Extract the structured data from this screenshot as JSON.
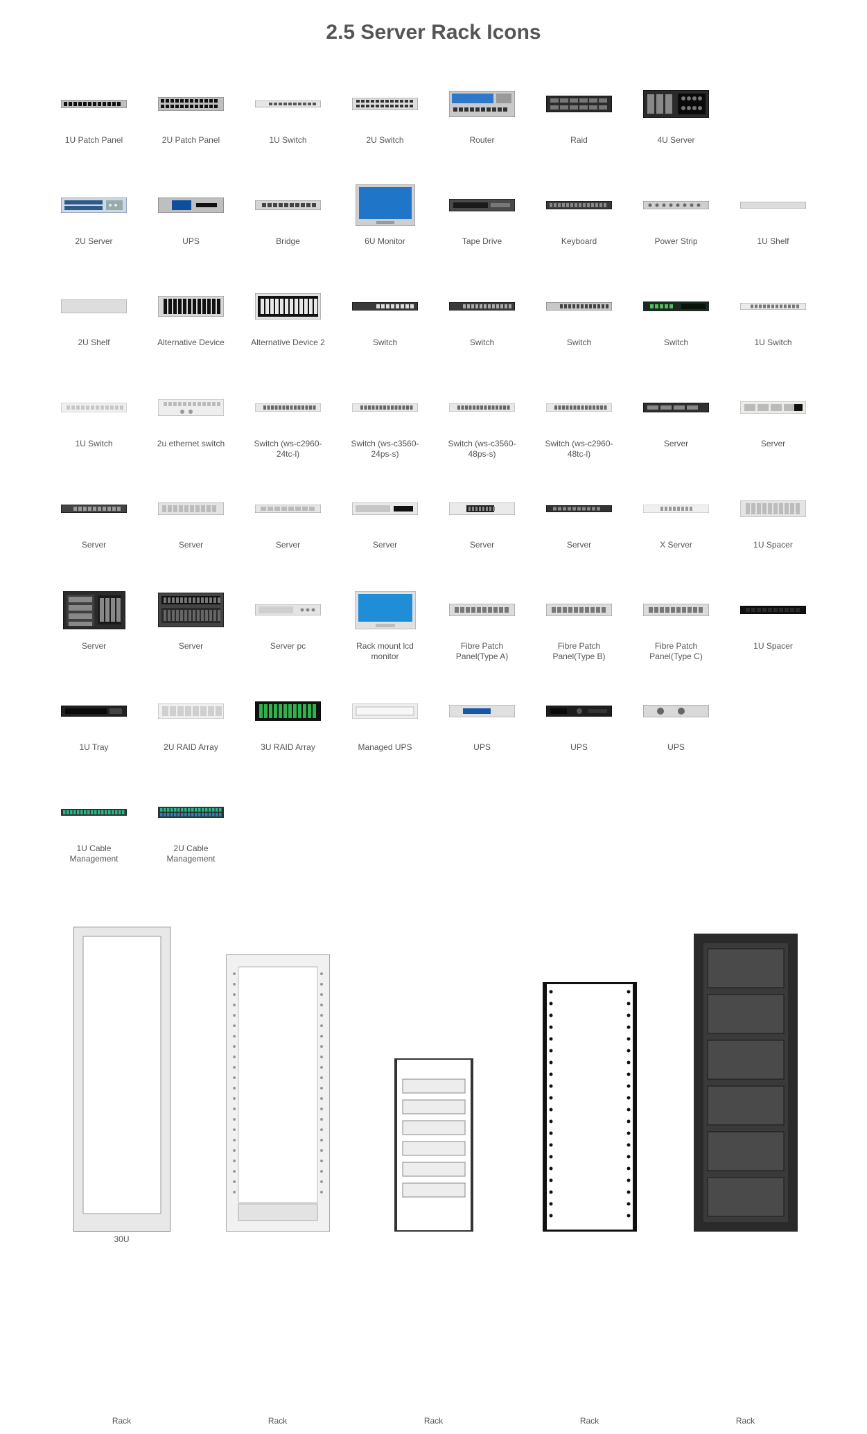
{
  "title": "2.5 Server Rack Icons",
  "items": [
    {
      "id": "1u-patch-panel",
      "label": "1U Patch Panel"
    },
    {
      "id": "2u-patch-panel",
      "label": "2U Patch Panel"
    },
    {
      "id": "1u-switch",
      "label": "1U Switch"
    },
    {
      "id": "2u-switch",
      "label": "2U Switch"
    },
    {
      "id": "router",
      "label": "Router"
    },
    {
      "id": "raid",
      "label": "Raid"
    },
    {
      "id": "4u-server",
      "label": "4U Server"
    },
    {
      "id": "blank",
      "label": ""
    },
    {
      "id": "2u-server",
      "label": "2U Server"
    },
    {
      "id": "ups",
      "label": "UPS"
    },
    {
      "id": "bridge",
      "label": "Bridge"
    },
    {
      "id": "6u-monitor",
      "label": "6U Monitor"
    },
    {
      "id": "tape-drive",
      "label": "Tape Drive"
    },
    {
      "id": "keyboard",
      "label": "Keyboard"
    },
    {
      "id": "power-strip",
      "label": "Power Strip"
    },
    {
      "id": "1u-shelf",
      "label": "1U Shelf"
    },
    {
      "id": "2u-shelf",
      "label": "2U Shelf"
    },
    {
      "id": "alternative-device",
      "label": "Alternative Device"
    },
    {
      "id": "alternative-device-2",
      "label": "Alternative Device 2"
    },
    {
      "id": "switch-a",
      "label": "Switch"
    },
    {
      "id": "switch-b",
      "label": "Switch"
    },
    {
      "id": "switch-c",
      "label": "Switch"
    },
    {
      "id": "switch-d",
      "label": "Switch"
    },
    {
      "id": "1u-switch-b",
      "label": "1U Switch"
    },
    {
      "id": "1u-switch-c",
      "label": "1U Switch"
    },
    {
      "id": "2u-ethernet-switch",
      "label": "2u ethernet switch"
    },
    {
      "id": "switch-ws-c2960-24tc-l",
      "label": "Switch (ws-c2960-24tc-l)"
    },
    {
      "id": "switch-ws-c3560-24ps-s",
      "label": "Switch (ws-c3560-24ps-s)"
    },
    {
      "id": "switch-ws-c3560-48ps-s",
      "label": "Switch (ws-c3560-48ps-s)"
    },
    {
      "id": "switch-ws-c2960-48tc-l",
      "label": "Switch (ws-c2960-48tc-l)"
    },
    {
      "id": "server-a",
      "label": "Server"
    },
    {
      "id": "server-b",
      "label": "Server"
    },
    {
      "id": "server-c",
      "label": "Server"
    },
    {
      "id": "server-d",
      "label": "Server"
    },
    {
      "id": "server-e",
      "label": "Server"
    },
    {
      "id": "server-f",
      "label": "Server"
    },
    {
      "id": "server-g",
      "label": "Server"
    },
    {
      "id": "server-h",
      "label": "Server"
    },
    {
      "id": "x-server",
      "label": "X Server"
    },
    {
      "id": "1u-spacer",
      "label": "1U Spacer"
    },
    {
      "id": "server-i",
      "label": "Server"
    },
    {
      "id": "server-j",
      "label": "Server"
    },
    {
      "id": "server-pc",
      "label": "Server pc"
    },
    {
      "id": "rack-mount-lcd-monitor",
      "label": "Rack mount lcd monitor"
    },
    {
      "id": "fibre-patch-panel-type-a",
      "label": "Fibre Patch Panel(Type A)"
    },
    {
      "id": "fibre-patch-panel-type-b",
      "label": "Fibre Patch Panel(Type B)"
    },
    {
      "id": "fibre-patch-panel-type-c",
      "label": "Fibre Patch Panel(Type C)"
    },
    {
      "id": "1u-spacer-b",
      "label": "1U Spacer"
    },
    {
      "id": "1u-tray",
      "label": "1U Tray"
    },
    {
      "id": "2u-raid-array",
      "label": "2U RAID Array"
    },
    {
      "id": "3u-raid-array",
      "label": "3U RAID Array"
    },
    {
      "id": "managed-ups",
      "label": "Managed UPS"
    },
    {
      "id": "ups-b",
      "label": "UPS"
    },
    {
      "id": "ups-c",
      "label": "UPS"
    },
    {
      "id": "ups-d",
      "label": "UPS"
    },
    {
      "id": "blank",
      "label": ""
    },
    {
      "id": "1u-cable-management",
      "label": "1U Cable Management"
    },
    {
      "id": "2u-cable-management",
      "label": "2U Cable Management"
    },
    {
      "id": "blank",
      "label": ""
    },
    {
      "id": "blank",
      "label": ""
    },
    {
      "id": "blank",
      "label": ""
    },
    {
      "id": "blank",
      "label": ""
    },
    {
      "id": "blank",
      "label": ""
    },
    {
      "id": "blank",
      "label": ""
    }
  ],
  "racks": [
    {
      "id": "rack-30u",
      "caption": "30U",
      "label": "Rack"
    },
    {
      "id": "rack-b",
      "caption": "",
      "label": "Rack"
    },
    {
      "id": "rack-c",
      "caption": "",
      "label": "Rack"
    },
    {
      "id": "rack-d",
      "caption": "",
      "label": "Rack"
    },
    {
      "id": "rack-e",
      "caption": "",
      "label": "Rack"
    }
  ]
}
